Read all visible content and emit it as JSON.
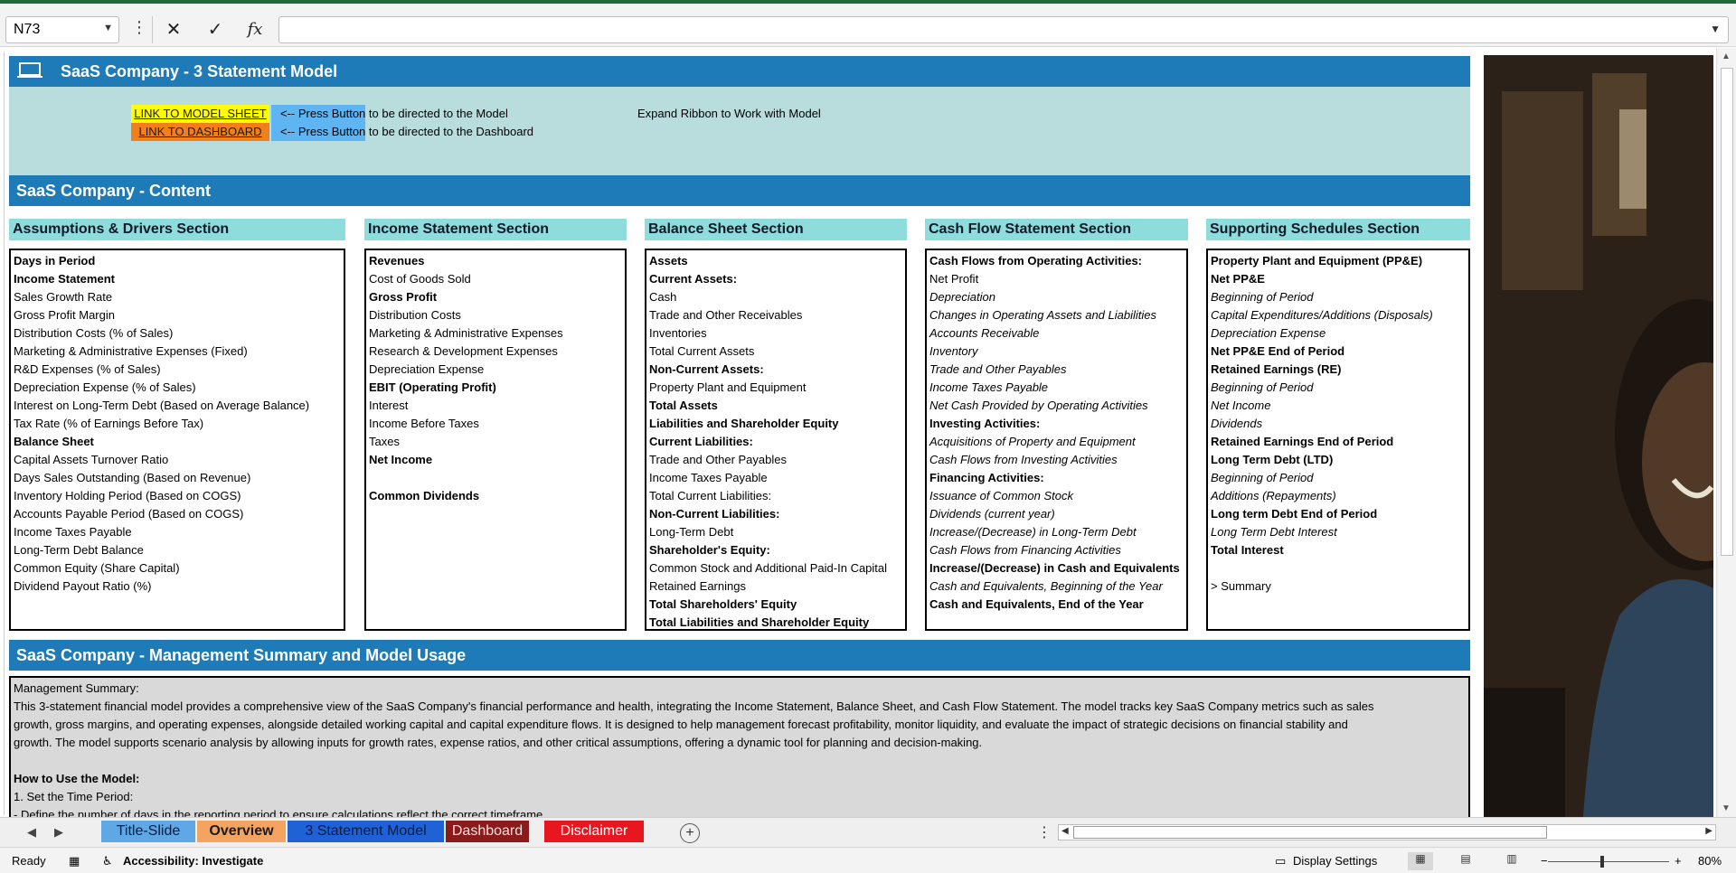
{
  "formula_bar": {
    "name_box": "N73",
    "formula": ""
  },
  "sheet": {
    "title": "SaaS Company - 3 Statement Model",
    "links": [
      {
        "label": "LINK TO MODEL SHEET",
        "hint": "<-- Press Button to be directed to the Model",
        "color": "#ffff00"
      },
      {
        "label": "LINK TO DASHBOARD",
        "hint": "<-- Press Button to be directed to the Dashboard",
        "color": "#f07f1c"
      }
    ],
    "expand_note": "Expand Ribbon to Work with Model",
    "content_title": "SaaS Company - Content",
    "sections": [
      {
        "title": "Assumptions & Drivers Section",
        "items": [
          {
            "text": "Days in Period",
            "style": "b"
          },
          {
            "text": "Income Statement",
            "style": "b"
          },
          {
            "text": "Sales Growth Rate",
            "style": ""
          },
          {
            "text": "Gross Profit Margin",
            "style": ""
          },
          {
            "text": "Distribution Costs (% of Sales)",
            "style": ""
          },
          {
            "text": "Marketing & Administrative Expenses (Fixed)",
            "style": ""
          },
          {
            "text": "R&D Expenses (% of Sales)",
            "style": ""
          },
          {
            "text": "Depreciation Expense (% of Sales)",
            "style": ""
          },
          {
            "text": "Interest on Long-Term Debt (Based on Average Balance)",
            "style": ""
          },
          {
            "text": "Tax Rate (% of Earnings Before Tax)",
            "style": ""
          },
          {
            "text": "Balance Sheet",
            "style": "b"
          },
          {
            "text": "Capital Assets Turnover Ratio",
            "style": ""
          },
          {
            "text": "Days Sales Outstanding (Based on Revenue)",
            "style": ""
          },
          {
            "text": "Inventory Holding Period (Based on COGS)",
            "style": ""
          },
          {
            "text": "Accounts Payable Period (Based on COGS)",
            "style": ""
          },
          {
            "text": "Income Taxes Payable",
            "style": ""
          },
          {
            "text": "Long-Term Debt Balance",
            "style": ""
          },
          {
            "text": "Common Equity (Share Capital)",
            "style": ""
          },
          {
            "text": "Dividend Payout Ratio (%)",
            "style": ""
          }
        ]
      },
      {
        "title": "Income Statement Section",
        "items": [
          {
            "text": "Revenues",
            "style": "b"
          },
          {
            "text": "Cost of Goods Sold",
            "style": ""
          },
          {
            "text": "Gross Profit",
            "style": "b"
          },
          {
            "text": "Distribution Costs",
            "style": ""
          },
          {
            "text": "Marketing & Administrative Expenses",
            "style": ""
          },
          {
            "text": "Research & Development Expenses",
            "style": ""
          },
          {
            "text": "Depreciation Expense",
            "style": ""
          },
          {
            "text": "EBIT (Operating Profit)",
            "style": "b"
          },
          {
            "text": "Interest",
            "style": ""
          },
          {
            "text": "Income Before Taxes",
            "style": ""
          },
          {
            "text": "Taxes",
            "style": ""
          },
          {
            "text": "Net Income",
            "style": "b"
          },
          {
            "text": "",
            "style": ""
          },
          {
            "text": "Common Dividends",
            "style": "b"
          }
        ]
      },
      {
        "title": "Balance Sheet Section",
        "items": [
          {
            "text": "Assets",
            "style": "b"
          },
          {
            "text": "Current Assets:",
            "style": "b"
          },
          {
            "text": "Cash",
            "style": ""
          },
          {
            "text": "Trade and Other Receivables",
            "style": ""
          },
          {
            "text": "Inventories",
            "style": ""
          },
          {
            "text": "Total Current Assets",
            "style": ""
          },
          {
            "text": "Non-Current Assets:",
            "style": "b"
          },
          {
            "text": "Property Plant and Equipment",
            "style": ""
          },
          {
            "text": "Total Assets",
            "style": "b"
          },
          {
            "text": "Liabilities and Shareholder Equity",
            "style": "b"
          },
          {
            "text": "Current Liabilities:",
            "style": "b"
          },
          {
            "text": "Trade and Other Payables",
            "style": ""
          },
          {
            "text": "Income Taxes Payable",
            "style": ""
          },
          {
            "text": "Total Current Liabilities:",
            "style": ""
          },
          {
            "text": "Non-Current Liabilities:",
            "style": "b"
          },
          {
            "text": "Long-Term Debt",
            "style": ""
          },
          {
            "text": "Shareholder's Equity:",
            "style": "b"
          },
          {
            "text": "Common Stock and Additional Paid-In Capital",
            "style": ""
          },
          {
            "text": "Retained Earnings",
            "style": ""
          },
          {
            "text": "Total Shareholders' Equity",
            "style": "b"
          },
          {
            "text": "Total Liabilities and Shareholder Equity",
            "style": "b"
          }
        ]
      },
      {
        "title": "Cash Flow Statement Section",
        "items": [
          {
            "text": "Cash Flows from Operating Activities:",
            "style": "b"
          },
          {
            "text": "Net Profit",
            "style": ""
          },
          {
            "text": "Depreciation",
            "style": "i"
          },
          {
            "text": "Changes in Operating Assets and Liabilities",
            "style": "i"
          },
          {
            "text": "Accounts Receivable",
            "style": "i"
          },
          {
            "text": "Inventory",
            "style": "i"
          },
          {
            "text": "Trade and Other Payables",
            "style": "i"
          },
          {
            "text": "Income Taxes Payable",
            "style": "i"
          },
          {
            "text": "Net Cash Provided by Operating Activities",
            "style": "i"
          },
          {
            "text": "Investing Activities:",
            "style": "b"
          },
          {
            "text": "Acquisitions of Property and Equipment",
            "style": "i"
          },
          {
            "text": "Cash Flows from Investing Activities",
            "style": "i"
          },
          {
            "text": "Financing Activities:",
            "style": "b"
          },
          {
            "text": "Issuance of Common Stock",
            "style": "i"
          },
          {
            "text": "Dividends (current year)",
            "style": "i"
          },
          {
            "text": "Increase/(Decrease) in Long-Term Debt",
            "style": "i"
          },
          {
            "text": "Cash Flows from Financing Activities",
            "style": "i"
          },
          {
            "text": "Increase/(Decrease) in Cash and Equivalents",
            "style": "b"
          },
          {
            "text": "Cash and Equivalents, Beginning of the Year",
            "style": "i"
          },
          {
            "text": "Cash and Equivalents, End of the Year",
            "style": "b"
          }
        ]
      },
      {
        "title": "Supporting Schedules Section",
        "items": [
          {
            "text": "Property Plant and Equipment (PP&E)",
            "style": "b"
          },
          {
            "text": "Net PP&E",
            "style": "b"
          },
          {
            "text": "Beginning of Period",
            "style": "i"
          },
          {
            "text": "Capital Expenditures/Additions (Disposals)",
            "style": "i"
          },
          {
            "text": "Depreciation Expense",
            "style": "i"
          },
          {
            "text": "Net PP&E End of Period",
            "style": "b"
          },
          {
            "text": "Retained Earnings (RE)",
            "style": "b"
          },
          {
            "text": "Beginning of Period",
            "style": "i"
          },
          {
            "text": "Net Income",
            "style": "i"
          },
          {
            "text": "Dividends",
            "style": "i"
          },
          {
            "text": "Retained Earnings End of Period",
            "style": "b"
          },
          {
            "text": "Long Term Debt (LTD)",
            "style": "b"
          },
          {
            "text": "Beginning of Period",
            "style": "i"
          },
          {
            "text": "Additions (Repayments)",
            "style": "i"
          },
          {
            "text": "Long term Debt End of Period",
            "style": "b"
          },
          {
            "text": "Long Term Debt Interest",
            "style": "i"
          },
          {
            "text": "Total Interest",
            "style": "b"
          },
          {
            "text": "",
            "style": ""
          },
          {
            "text": "> Summary",
            "style": ""
          }
        ]
      }
    ],
    "mgmt_title": "SaaS Company - Management Summary and Model Usage",
    "mgmt_lines": [
      {
        "text": "Management Summary:",
        "style": ""
      },
      {
        "text": "This 3-statement financial model provides a comprehensive view of the SaaS Company's financial performance and health, integrating the Income Statement, Balance Sheet, and Cash Flow Statement. The model tracks key SaaS Company metrics such as sales",
        "style": ""
      },
      {
        "text": "growth, gross margins, and operating expenses, alongside detailed working capital and capital expenditure flows. It is designed to help management forecast profitability, monitor liquidity, and evaluate the impact of strategic decisions on financial stability and",
        "style": ""
      },
      {
        "text": "growth. The model supports scenario analysis by allowing inputs for growth rates, expense ratios, and other critical assumptions, offering a dynamic tool for planning and decision-making.",
        "style": ""
      },
      {
        "text": "",
        "style": ""
      },
      {
        "text": "How to Use the Model:",
        "style": "b"
      },
      {
        "text": "1. Set the Time Period:",
        "style": ""
      },
      {
        "text": "  - Define the number of days in the reporting period to ensure calculations reflect the correct timeframe.",
        "style": ""
      }
    ]
  },
  "tabs": [
    {
      "label": "Title-Slide",
      "bg": "#5fa8e6",
      "fg": "#0d1a3a",
      "bold": false
    },
    {
      "label": "Overview",
      "bg": "#f4a460",
      "fg": "#1a1a1a",
      "bold": true
    },
    {
      "label": "3 Statement Model",
      "bg": "#1e62d6",
      "fg": "#0d1a3a",
      "bold": false
    },
    {
      "label": "Dashboard",
      "bg": "#8b1a1a",
      "fg": "#ffdede",
      "bold": false
    },
    {
      "label": "Disclaimer",
      "bg": "#e8161e",
      "fg": "#ffffff",
      "bold": false
    }
  ],
  "status": {
    "ready": "Ready",
    "accessibility": "Accessibility: Investigate",
    "display_settings": "Display Settings",
    "zoom": "80%"
  }
}
